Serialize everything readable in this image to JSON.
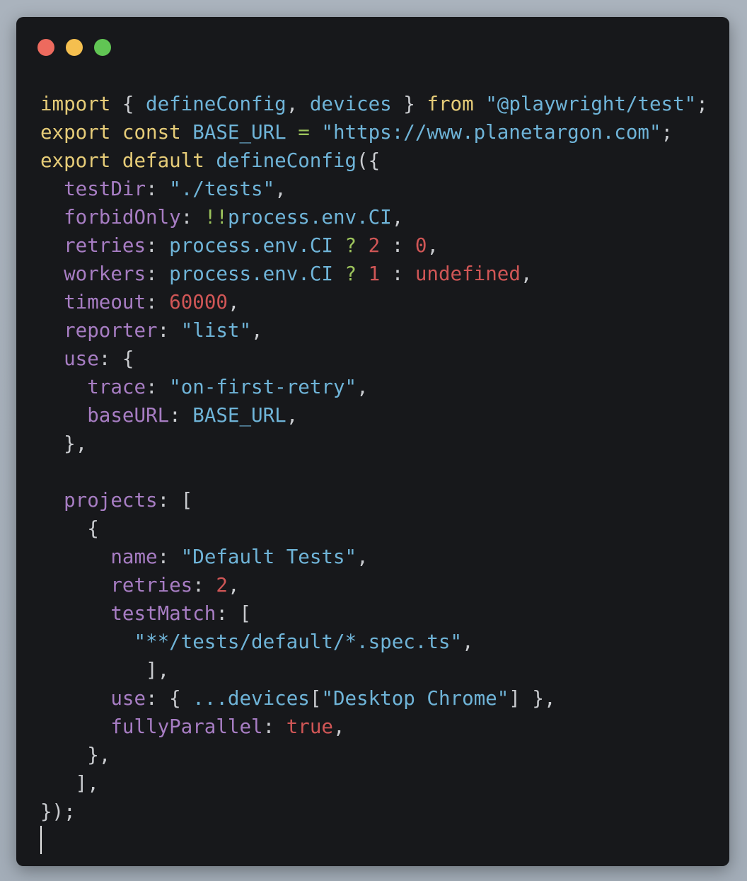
{
  "window": {
    "controls": [
      {
        "name": "close",
        "color": "#ed6a5e"
      },
      {
        "name": "minimize",
        "color": "#f5bf4f"
      },
      {
        "name": "maximize",
        "color": "#61c554"
      }
    ],
    "colors": {
      "background": "#17181b",
      "keyword": "#e6cc78",
      "identifier": "#6fb4d8",
      "property": "#a77dc3",
      "literal": "#d05656",
      "operator": "#9dc45c",
      "punctuation": "#c9cbcf"
    }
  },
  "code": {
    "lines": [
      [
        [
          "kw",
          "import"
        ],
        [
          "p",
          " { "
        ],
        [
          "b",
          "defineConfig"
        ],
        [
          "p",
          ", "
        ],
        [
          "b",
          "devices"
        ],
        [
          "p",
          " } "
        ],
        [
          "kw",
          "from"
        ],
        [
          "p",
          " "
        ],
        [
          "b",
          "\"@playwright/test\""
        ],
        [
          "p",
          ";"
        ]
      ],
      [
        [
          "kw",
          "export const"
        ],
        [
          "p",
          " "
        ],
        [
          "b",
          "BASE_URL"
        ],
        [
          "p",
          " "
        ],
        [
          "g",
          "="
        ],
        [
          "p",
          " "
        ],
        [
          "b",
          "\"https://www.planetargon.com\""
        ],
        [
          "p",
          ";"
        ]
      ],
      [
        [
          "kw",
          "export default"
        ],
        [
          "p",
          " "
        ],
        [
          "b",
          "defineConfig"
        ],
        [
          "p",
          "({"
        ]
      ],
      [
        [
          "p",
          "  "
        ],
        [
          "pr",
          "testDir"
        ],
        [
          "p",
          ": "
        ],
        [
          "b",
          "\"./tests\""
        ],
        [
          "p",
          ","
        ]
      ],
      [
        [
          "p",
          "  "
        ],
        [
          "pr",
          "forbidOnly"
        ],
        [
          "p",
          ": "
        ],
        [
          "g",
          "!!"
        ],
        [
          "b",
          "process.env.CI"
        ],
        [
          "p",
          ","
        ]
      ],
      [
        [
          "p",
          "  "
        ],
        [
          "pr",
          "retries"
        ],
        [
          "p",
          ": "
        ],
        [
          "b",
          "process.env.CI"
        ],
        [
          "p",
          " "
        ],
        [
          "g",
          "?"
        ],
        [
          "p",
          " "
        ],
        [
          "r",
          "2"
        ],
        [
          "p",
          " : "
        ],
        [
          "r",
          "0"
        ],
        [
          "p",
          ","
        ]
      ],
      [
        [
          "p",
          "  "
        ],
        [
          "pr",
          "workers"
        ],
        [
          "p",
          ": "
        ],
        [
          "b",
          "process.env.CI"
        ],
        [
          "p",
          " "
        ],
        [
          "g",
          "?"
        ],
        [
          "p",
          " "
        ],
        [
          "r",
          "1"
        ],
        [
          "p",
          " : "
        ],
        [
          "r",
          "undefined"
        ],
        [
          "p",
          ","
        ]
      ],
      [
        [
          "p",
          "  "
        ],
        [
          "pr",
          "timeout"
        ],
        [
          "p",
          ": "
        ],
        [
          "r",
          "60000"
        ],
        [
          "p",
          ","
        ]
      ],
      [
        [
          "p",
          "  "
        ],
        [
          "pr",
          "reporter"
        ],
        [
          "p",
          ": "
        ],
        [
          "b",
          "\"list\""
        ],
        [
          "p",
          ","
        ]
      ],
      [
        [
          "p",
          "  "
        ],
        [
          "pr",
          "use"
        ],
        [
          "p",
          ": {"
        ]
      ],
      [
        [
          "p",
          "    "
        ],
        [
          "pr",
          "trace"
        ],
        [
          "p",
          ": "
        ],
        [
          "b",
          "\"on-first-retry\""
        ],
        [
          "p",
          ","
        ]
      ],
      [
        [
          "p",
          "    "
        ],
        [
          "pr",
          "baseURL"
        ],
        [
          "p",
          ": "
        ],
        [
          "b",
          "BASE_URL"
        ],
        [
          "p",
          ","
        ]
      ],
      [
        [
          "p",
          "  },"
        ]
      ],
      [
        [
          "p",
          ""
        ]
      ],
      [
        [
          "p",
          "  "
        ],
        [
          "pr",
          "projects"
        ],
        [
          "p",
          ": ["
        ]
      ],
      [
        [
          "p",
          "    {"
        ]
      ],
      [
        [
          "p",
          "      "
        ],
        [
          "pr",
          "name"
        ],
        [
          "p",
          ": "
        ],
        [
          "b",
          "\"Default Tests\""
        ],
        [
          "p",
          ","
        ]
      ],
      [
        [
          "p",
          "      "
        ],
        [
          "pr",
          "retries"
        ],
        [
          "p",
          ": "
        ],
        [
          "r",
          "2"
        ],
        [
          "p",
          ","
        ]
      ],
      [
        [
          "p",
          "      "
        ],
        [
          "pr",
          "testMatch"
        ],
        [
          "p",
          ": ["
        ]
      ],
      [
        [
          "p",
          "        "
        ],
        [
          "b",
          "\"**/tests/default/*.spec.ts\""
        ],
        [
          "p",
          ","
        ]
      ],
      [
        [
          "p",
          "         ],"
        ]
      ],
      [
        [
          "p",
          "      "
        ],
        [
          "pr",
          "use"
        ],
        [
          "p",
          ": { "
        ],
        [
          "b",
          "...devices"
        ],
        [
          "p",
          "["
        ],
        [
          "b",
          "\"Desktop Chrome\""
        ],
        [
          "p",
          "] },"
        ]
      ],
      [
        [
          "p",
          "      "
        ],
        [
          "pr",
          "fullyParallel"
        ],
        [
          "p",
          ": "
        ],
        [
          "r",
          "true"
        ],
        [
          "p",
          ","
        ]
      ],
      [
        [
          "p",
          "    },"
        ]
      ],
      [
        [
          "p",
          "   ],"
        ]
      ],
      [
        [
          "p",
          "});"
        ]
      ]
    ]
  }
}
